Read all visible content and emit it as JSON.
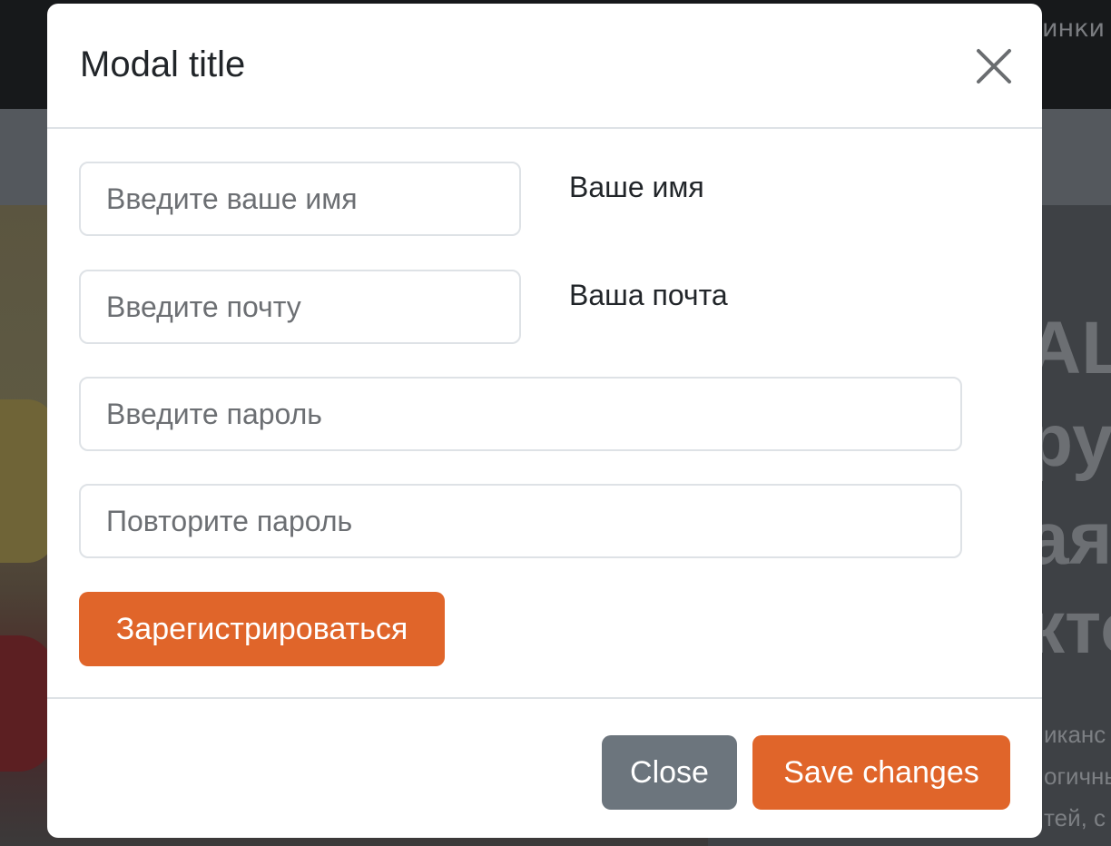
{
  "background": {
    "nav_text": "инки",
    "hero_big_lines": [
      "AL",
      "ру",
      "ая",
      "кто"
    ],
    "hero_small_lines": [
      "иканс",
      "огичны",
      "тей, с"
    ]
  },
  "modal": {
    "title": "Modal title",
    "close_icon": "close-icon",
    "form": {
      "name_placeholder": "Введите ваше имя",
      "name_label": "Ваше имя",
      "email_placeholder": "Введите почту",
      "email_label": "Ваша почта",
      "password_placeholder": "Введите пароль",
      "password_repeat_placeholder": "Повторите пароль",
      "submit_label": "Зарегистрироваться"
    },
    "footer": {
      "close_label": "Close",
      "save_label": "Save changes"
    }
  },
  "colors": {
    "accent": "#e0652a",
    "secondary": "#6c757d",
    "navbar": "#17191b"
  }
}
